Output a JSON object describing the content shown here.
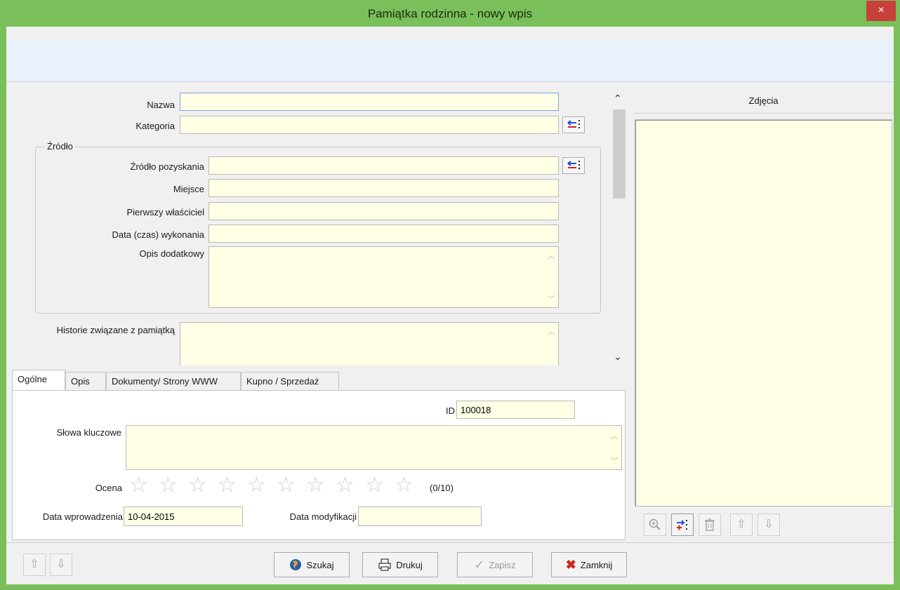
{
  "window": {
    "title": "Pamiątka rodzinna - nowy wpis",
    "close_glyph": "×"
  },
  "form": {
    "nazwa_label": "Nazwa",
    "kategoria_label": "Kategoria",
    "zrodlo_group_label": "Źródło",
    "zrodlo_pozyskania_label": "Źródło pozyskania",
    "miejsce_label": "Miejsce",
    "pierwszy_wlasciciel_label": "Pierwszy właściciel",
    "data_wykonania_label": "Data (czas) wykonania",
    "opis_dodatkowy_label": "Opis dodatkowy",
    "historie_label": "Historie związane z pamiątką",
    "nazwa_value": "",
    "kategoria_value": ""
  },
  "tabs": {
    "items": [
      "Ogólne",
      "Opis",
      "Dokumenty/ Strony WWW",
      "Kupno / Sprzedaż"
    ],
    "active": "Ogólne"
  },
  "general": {
    "id_label": "ID",
    "id_value": "100018",
    "slowa_kluczowe_label": "Słowa kluczowe",
    "ocena_label": "Ocena",
    "rating_value": 0,
    "rating_max": 10,
    "rating_text": "(0/10)",
    "data_wprowadzenia_label": "Data wprowadzenia",
    "data_wprowadzenia_value": "10-04-2015",
    "data_modyfikacji_label": "Data modyfikacji",
    "data_modyfikacji_value": ""
  },
  "photos": {
    "header": "Zdjęcia"
  },
  "footer": {
    "szukaj_label": "Szukaj",
    "drukuj_label": "Drukuj",
    "zapisz_label": "Zapisz",
    "zamknij_label": "Zamknij"
  },
  "colors": {
    "titlebar": "#7ac05a",
    "field_bg": "#ffffe6",
    "close": "#c7413a"
  }
}
